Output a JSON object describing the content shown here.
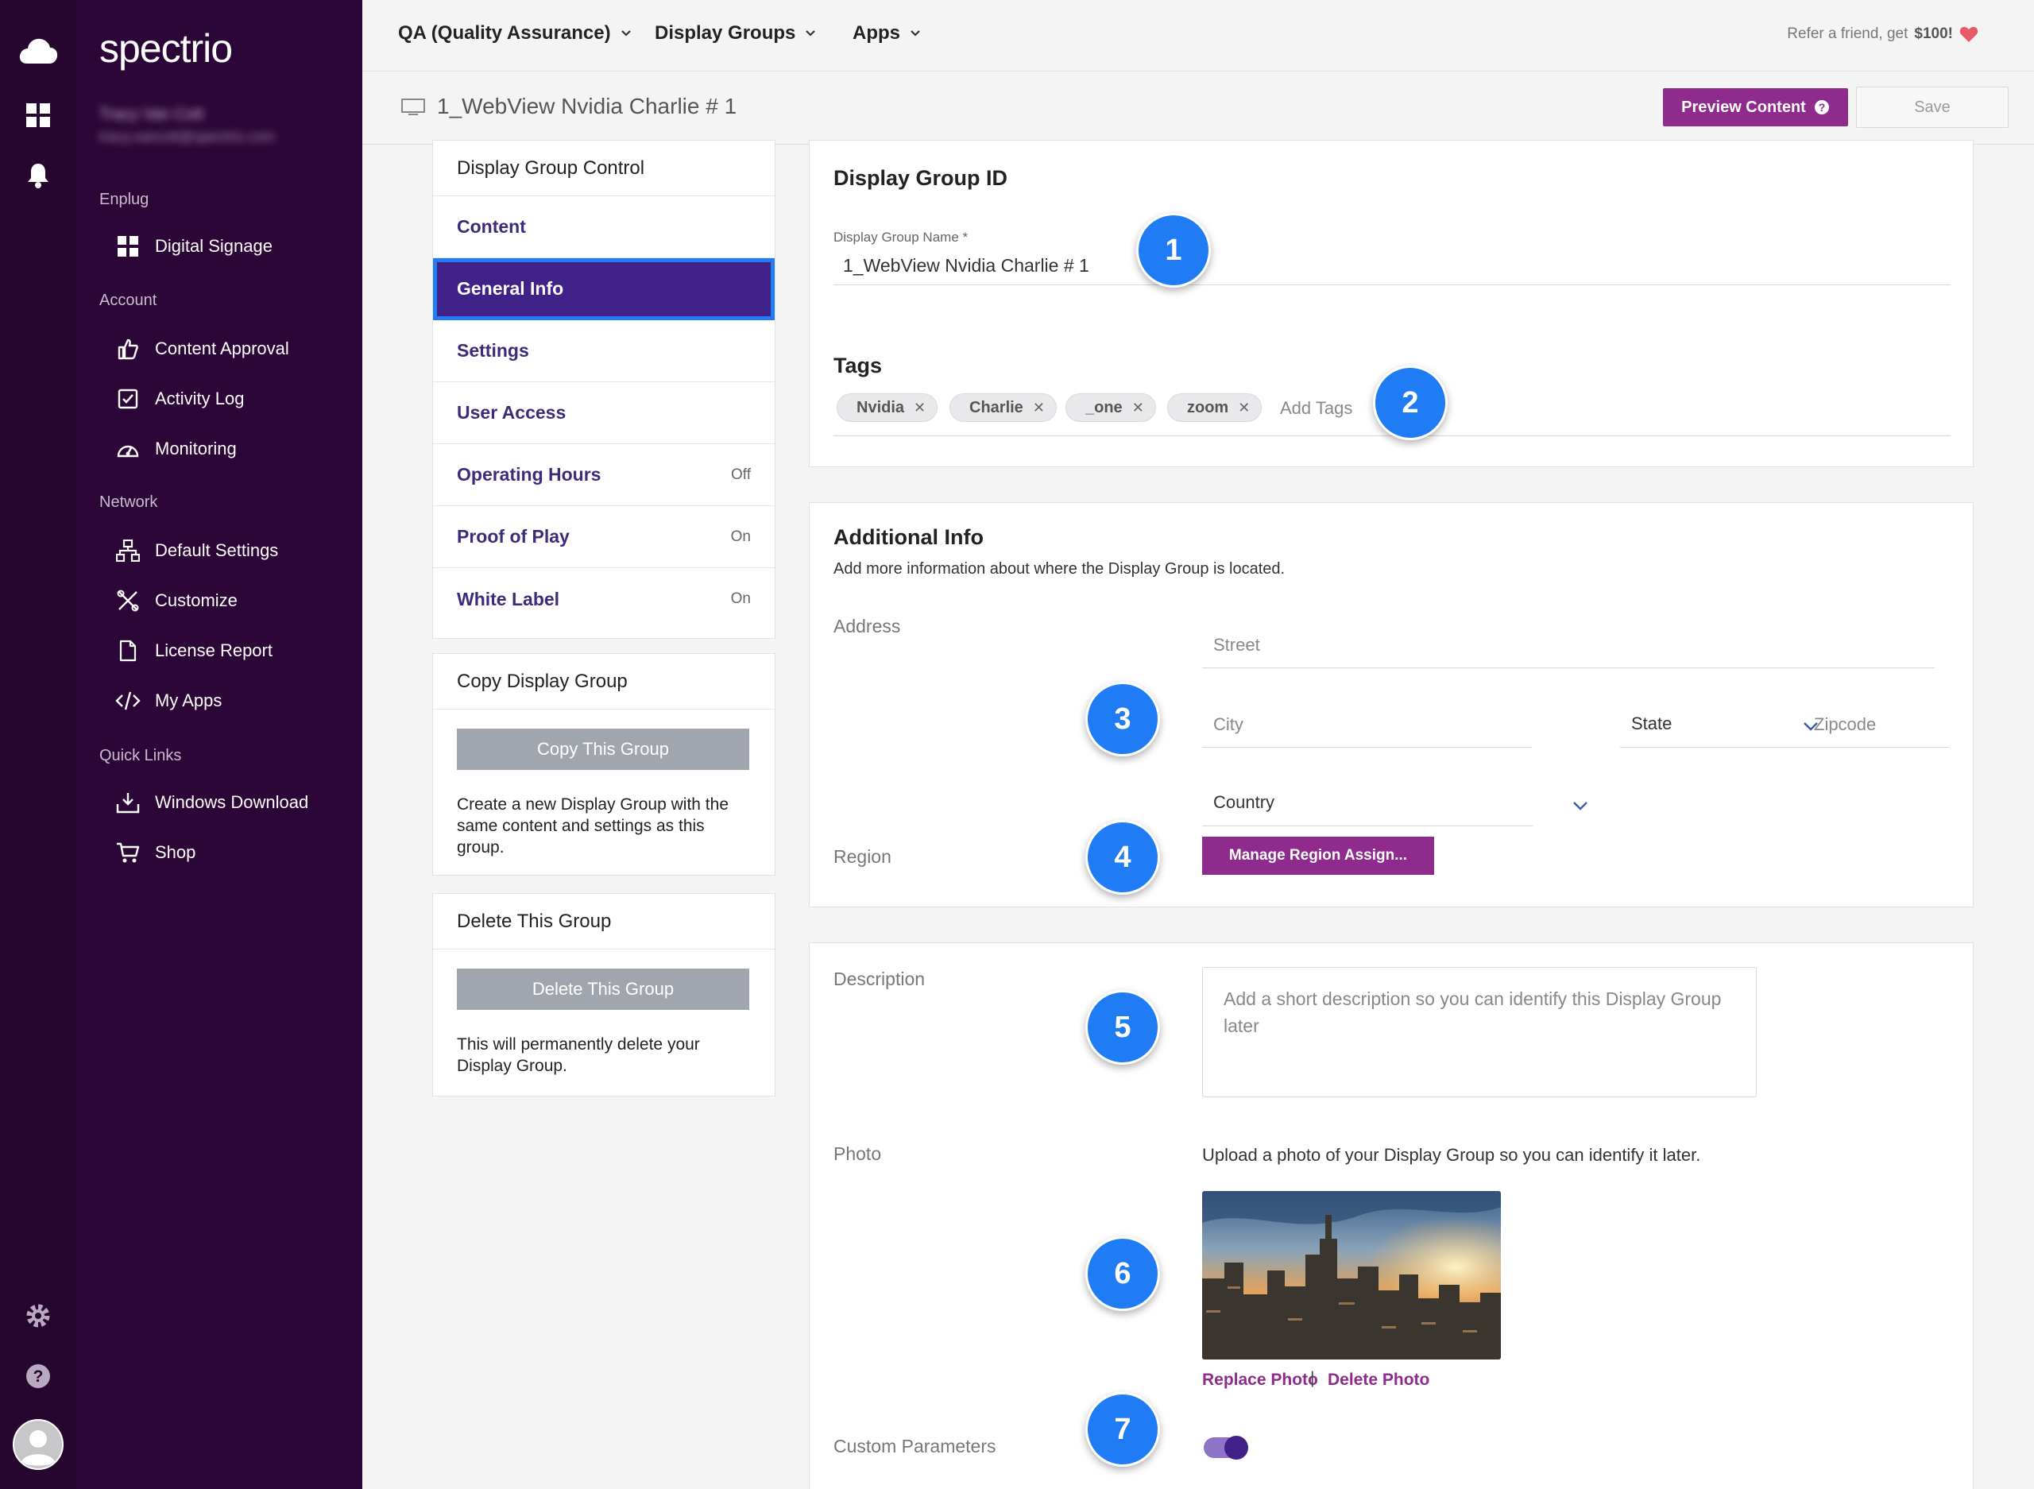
{
  "app": {
    "logo": "spectrio",
    "user_name": "Tracy Van Cott",
    "user_email": "tracy.vancott@spectrio.com"
  },
  "sidebar": {
    "sections": [
      {
        "label": "Enplug",
        "items": [
          {
            "label": "Digital Signage",
            "icon": "grid-icon"
          }
        ]
      },
      {
        "label": "Account",
        "items": [
          {
            "label": "Content Approval",
            "icon": "thumbs-up-icon"
          },
          {
            "label": "Activity Log",
            "icon": "checkbox-icon"
          },
          {
            "label": "Monitoring",
            "icon": "gauge-icon"
          }
        ]
      },
      {
        "label": "Network",
        "items": [
          {
            "label": "Default Settings",
            "icon": "network-icon"
          },
          {
            "label": "Customize",
            "icon": "tools-icon"
          },
          {
            "label": "License Report",
            "icon": "document-icon"
          },
          {
            "label": "My Apps",
            "icon": "code-icon"
          }
        ]
      },
      {
        "label": "Quick Links",
        "items": [
          {
            "label": "Windows Download",
            "icon": "download-icon"
          },
          {
            "label": "Shop",
            "icon": "cart-icon"
          }
        ]
      }
    ]
  },
  "header": {
    "menus": [
      "QA (Quality Assurance)",
      "Display Groups",
      "Apps"
    ],
    "refer_text": "Refer a friend, get",
    "refer_amount": "$100!",
    "page_title": "1_WebView Nvidia Charlie # 1",
    "preview_label": "Preview Content",
    "save_label": "Save"
  },
  "control_panel": {
    "title": "Display Group Control",
    "items": [
      {
        "label": "Content",
        "state": ""
      },
      {
        "label": "General Info",
        "state": ""
      },
      {
        "label": "Settings",
        "state": ""
      },
      {
        "label": "User Access",
        "state": ""
      },
      {
        "label": "Operating Hours",
        "state": "Off"
      },
      {
        "label": "Proof of Play",
        "state": "On"
      },
      {
        "label": "White Label",
        "state": "On"
      }
    ],
    "active_item": "General Info"
  },
  "copy_panel": {
    "title": "Copy Display Group",
    "button": "Copy This Group",
    "text": "Create a new Display Group with the same content and settings as this group."
  },
  "delete_panel": {
    "title": "Delete This Group",
    "button": "Delete This Group",
    "text": "This will permanently delete your Display Group."
  },
  "id_card": {
    "title": "Display Group ID",
    "name_label": "Display Group Name *",
    "name_value": "1_WebView Nvidia Charlie # 1",
    "tags_title": "Tags",
    "tags": [
      "Nvidia",
      "Charlie",
      "_one",
      "zoom"
    ],
    "add_tags_placeholder": "Add Tags"
  },
  "additional_card": {
    "title": "Additional Info",
    "subtitle": "Add more information about where the Display Group is located.",
    "address_label": "Address",
    "street_placeholder": "Street",
    "city_placeholder": "City",
    "state_placeholder": "State",
    "zip_placeholder": "Zipcode",
    "country_placeholder": "Country",
    "region_label": "Region",
    "region_button": "Manage Region Assign..."
  },
  "details_card": {
    "description_label": "Description",
    "description_placeholder": "Add a short description so you can identify this Display Group later",
    "photo_label": "Photo",
    "photo_hint": "Upload a photo of your Display Group so you can identify it later.",
    "replace_photo": "Replace Photo",
    "separator": "|",
    "delete_photo": "Delete Photo",
    "custom_params_label": "Custom Parameters",
    "custom_params_enabled": true
  },
  "callouts": [
    "1",
    "2",
    "3",
    "4",
    "5",
    "6",
    "7"
  ],
  "colors": {
    "rail": "#26052f",
    "sidebar": "#2c0637",
    "accent_purple": "#8e2b8c",
    "active_nav": "#3f2188",
    "callout_blue": "#1f7cf4"
  }
}
